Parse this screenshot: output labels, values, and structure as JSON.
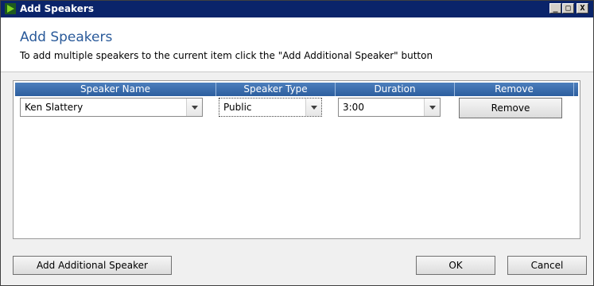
{
  "window": {
    "title": "Add Speakers",
    "minimize_glyph": "_",
    "maximize_glyph": "□",
    "close_glyph": "X"
  },
  "header": {
    "title": "Add Speakers",
    "subtitle": "To add multiple speakers to the current item click the \"Add Additional Speaker\" button"
  },
  "grid": {
    "columns": [
      "Speaker Name",
      "Speaker Type",
      "Duration",
      "Remove"
    ],
    "rows": [
      {
        "speaker_name": "Ken Slattery",
        "speaker_type": "Public",
        "duration": "3:00",
        "remove_label": "Remove"
      }
    ]
  },
  "footer": {
    "add_label": "Add Additional Speaker",
    "ok_label": "OK",
    "cancel_label": "Cancel"
  },
  "colors": {
    "titlebar": "#0a246a",
    "heading": "#2a5a9a",
    "grid_header": "#2c5e9e"
  }
}
